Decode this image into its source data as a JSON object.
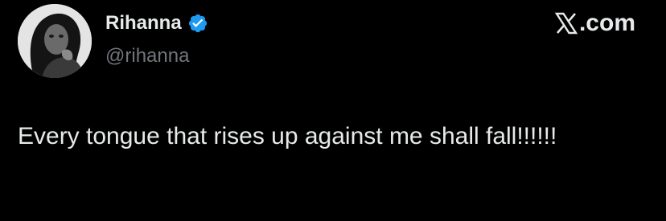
{
  "author": {
    "display_name": "Rihanna",
    "handle": "@rihanna",
    "verified": true,
    "avatar_icon": "profile-photo",
    "verified_icon": "verified-badge-icon",
    "verified_color": "#1d9bf0"
  },
  "brand": {
    "logo_icon": "x-logo-icon",
    "suffix": ".com"
  },
  "tweet": {
    "text": "Every tongue that rises up against me shall fall!!!!!!"
  },
  "colors": {
    "background": "#000000",
    "primary_text": "#e7e9ea",
    "secondary_text": "#71767b"
  }
}
